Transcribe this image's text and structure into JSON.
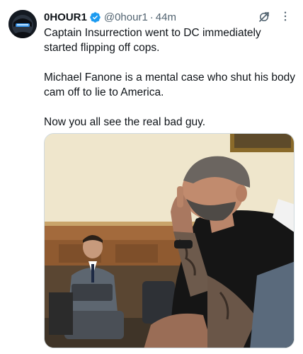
{
  "author": {
    "display_name": "0HOUR1",
    "handle": "@0hour1",
    "time_ago": "44m",
    "separator": "·"
  },
  "icons": {
    "avatar": "avatar-icon",
    "verified": "verified-badge-icon",
    "grok": "grok-icon",
    "more": "more-icon"
  },
  "tweet": {
    "lines": [
      "Captain Insurrection went to DC immediately started flipping off cops.",
      "Michael Fanone is a mental case who shut his body cam off to lie to America.",
      "Now you all see the real bad guy."
    ]
  },
  "colors": {
    "verified": "#1d9bf0",
    "secondary_text": "#536471"
  }
}
